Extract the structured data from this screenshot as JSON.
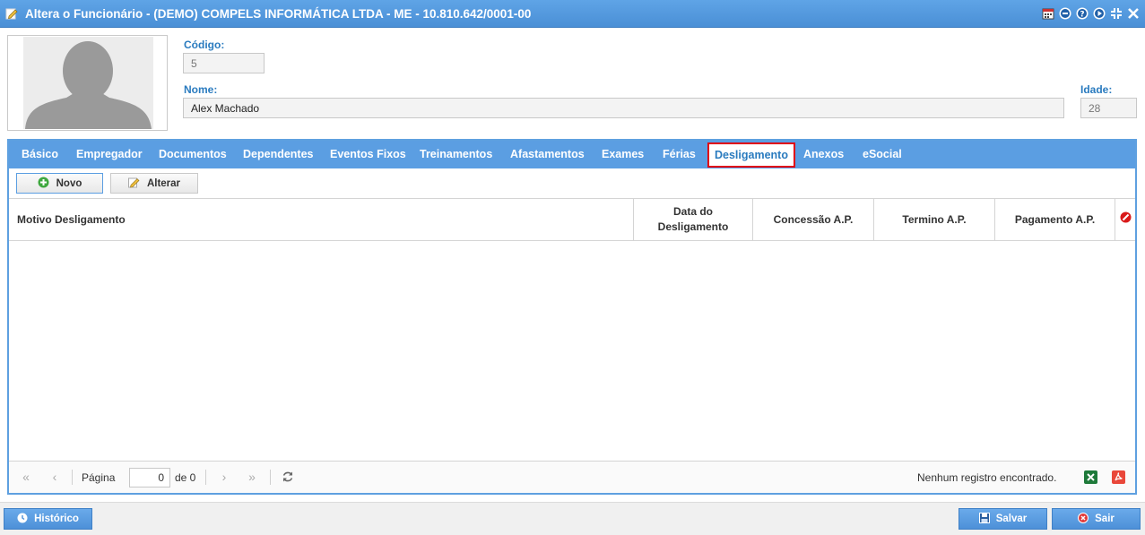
{
  "window": {
    "title": "Altera o Funcionário - (DEMO) COMPELS INFORMÁTICA LTDA - ME - 10.810.642/0001-00",
    "tools": [
      "calendar-icon",
      "minimize-icon",
      "help-icon",
      "play-icon",
      "collapse-icon",
      "close-icon"
    ]
  },
  "form": {
    "codigo_label": "Código:",
    "codigo_value": "5",
    "nome_label": "Nome:",
    "nome_value": "Alex Machado",
    "idade_label": "Idade:",
    "idade_value": "28"
  },
  "tabs": [
    {
      "label": "Básico"
    },
    {
      "label": "Empregador"
    },
    {
      "label": "Documentos"
    },
    {
      "label": "Dependentes"
    },
    {
      "label": "Eventos Fixos"
    },
    {
      "label": "Treinamentos"
    },
    {
      "label": "Afastamentos"
    },
    {
      "label": "Exames"
    },
    {
      "label": "Férias"
    },
    {
      "label": "Desligamento",
      "active": true
    },
    {
      "label": "Anexos"
    },
    {
      "label": "eSocial"
    }
  ],
  "toolbar": {
    "novo_label": "Novo",
    "alterar_label": "Alterar"
  },
  "grid": {
    "columns": [
      {
        "label": "Motivo Desligamento"
      },
      {
        "label": "Data do Desligamento"
      },
      {
        "label": "Concessão A.P."
      },
      {
        "label": "Termino A.P."
      },
      {
        "label": "Pagamento A.P."
      }
    ],
    "rows": []
  },
  "pager": {
    "page_label": "Página",
    "page_value": "0",
    "of_label": "de 0",
    "status": "Nenhum registro encontrado."
  },
  "footer": {
    "historico_label": "Histórico",
    "salvar_label": "Salvar",
    "sair_label": "Sair"
  },
  "colors": {
    "accent": "#5b9ee2",
    "label": "#2a7bbf",
    "active_tab_border": "#e00012"
  }
}
